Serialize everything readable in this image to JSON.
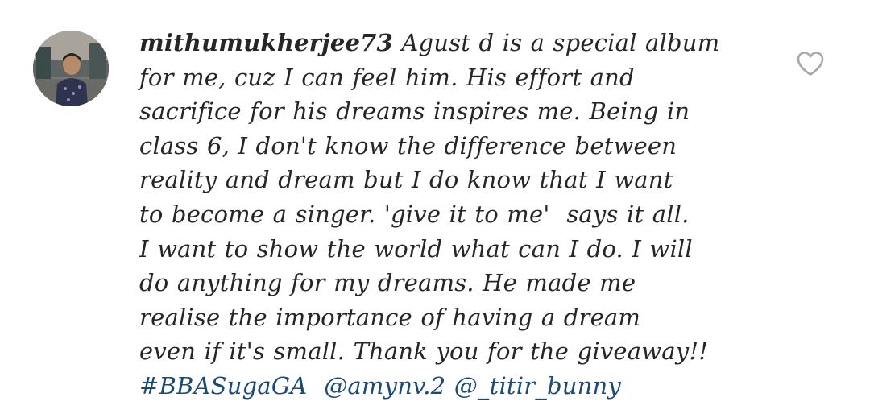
{
  "comment": {
    "username": "mithumukherjee73",
    "text_lines": [
      " Agust d is a special album",
      "for me, cuz I can feel him. His effort and",
      "sacrifice for his dreams inspires me. Being in",
      "class 6, I don't know the difference between",
      "reality and dream but I do know that I want",
      "to become a singer. 'give it to me'  says it all.",
      "I want to show the world what can I do. I will",
      "do anything for my dreams. He made me",
      "realise the importance of having a dream",
      "even if it's small. Thank you for the giveaway!!"
    ],
    "tags": {
      "hashtag": "#BBASugaGA",
      "mention_1": "@amynv.2",
      "mention_2": "@_titir_bunny"
    }
  },
  "icons": {
    "avatar": "user-avatar",
    "like": "heart-outline-icon"
  },
  "colors": {
    "text": "#262626",
    "link": "#1b4a78",
    "icon": "#a8a8a8",
    "background": "#ffffff"
  }
}
